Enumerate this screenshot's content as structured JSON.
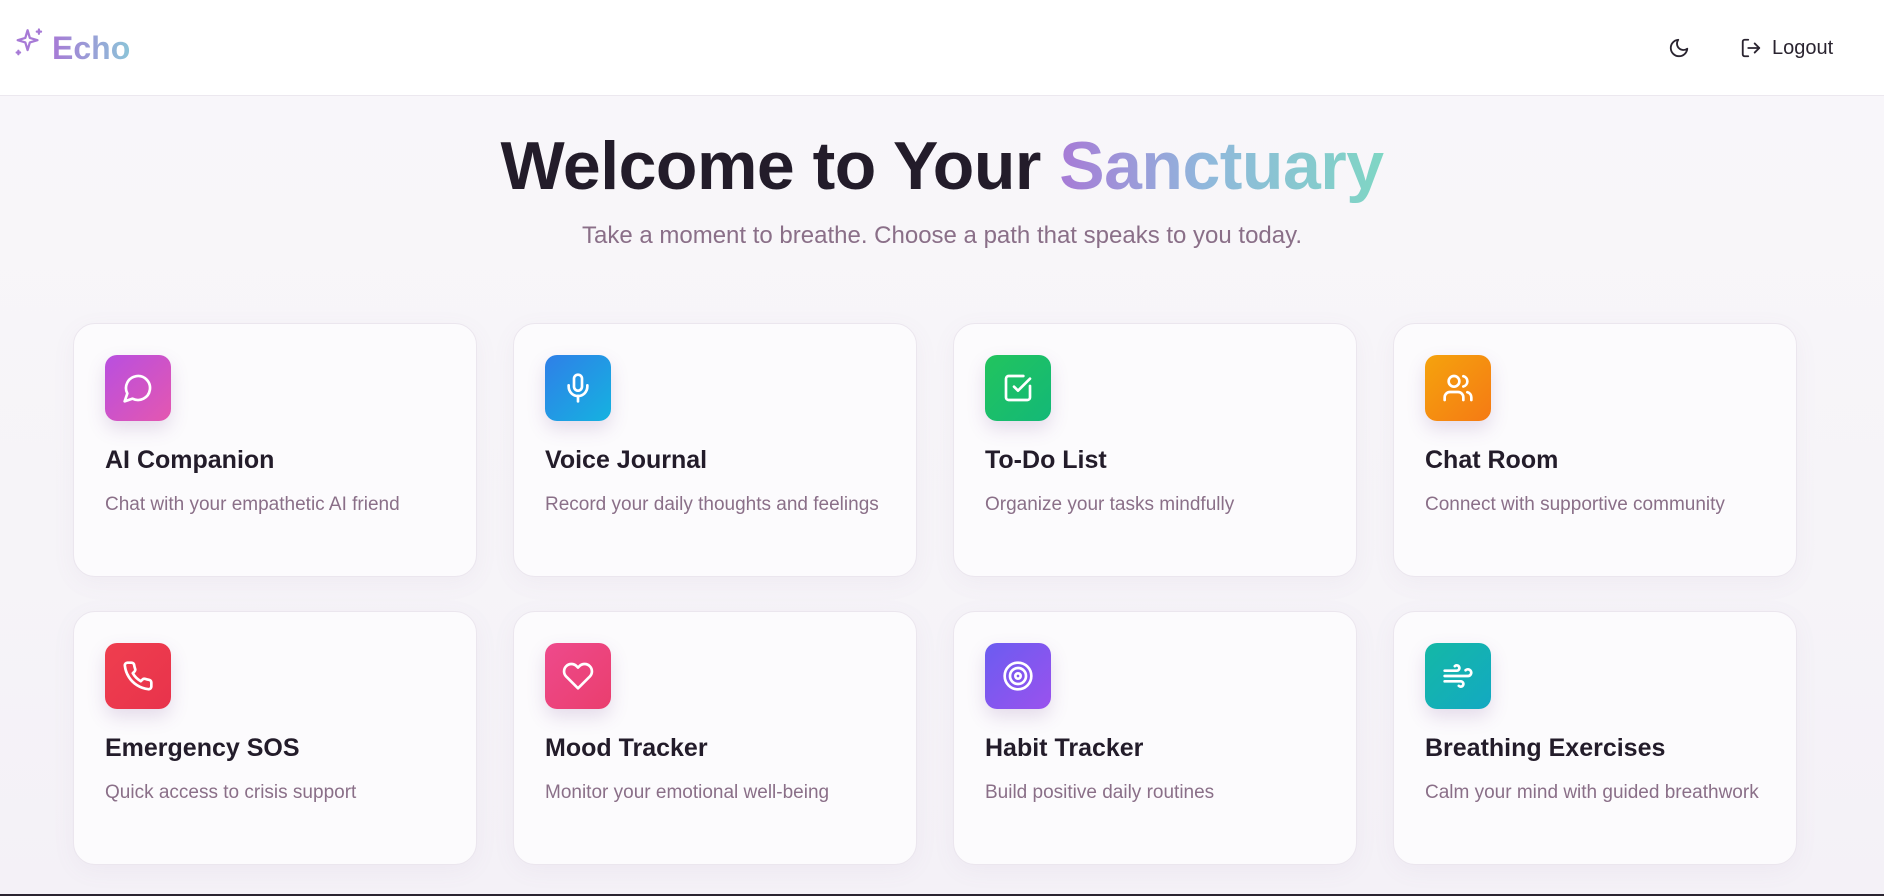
{
  "header": {
    "app_name": "Echo",
    "logout_label": "Logout"
  },
  "hero": {
    "title_prefix": "Welcome to Your ",
    "title_accent": "Sanctuary",
    "subtitle": "Take a moment to breathe. Choose a path that speaks to you today."
  },
  "cards": [
    {
      "title": "AI Companion",
      "description": "Chat with your empathetic AI friend",
      "icon": "message-circle-icon",
      "color_from": "#b84fe0",
      "color_to": "#e457b0"
    },
    {
      "title": "Voice Journal",
      "description": "Record your daily thoughts and feelings",
      "icon": "microphone-icon",
      "color_from": "#2f7fe8",
      "color_to": "#15b2e0"
    },
    {
      "title": "To-Do List",
      "description": "Organize your tasks mindfully",
      "icon": "checkbox-icon",
      "color_from": "#22c45e",
      "color_to": "#13b877"
    },
    {
      "title": "Chat Room",
      "description": "Connect with supportive community",
      "icon": "users-icon",
      "color_from": "#f5a30d",
      "color_to": "#f57a14"
    },
    {
      "title": "Emergency SOS",
      "description": "Quick access to crisis support",
      "icon": "phone-icon",
      "color_from": "#ef3e4f",
      "color_to": "#e8334b"
    },
    {
      "title": "Mood Tracker",
      "description": "Monitor your emotional well-being",
      "icon": "heart-icon",
      "color_from": "#ee4a8c",
      "color_to": "#ea3e6e"
    },
    {
      "title": "Habit Tracker",
      "description": "Build positive daily routines",
      "icon": "target-icon",
      "color_from": "#6b5cf0",
      "color_to": "#9a52ee"
    },
    {
      "title": "Breathing Exercises",
      "description": "Calm your mind with guided breathwork",
      "icon": "wind-icon",
      "color_from": "#14b8a6",
      "color_to": "#13a9c2"
    }
  ]
}
